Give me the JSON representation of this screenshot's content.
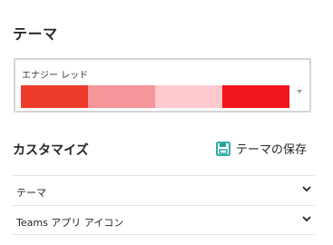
{
  "theme_section": {
    "title": "テーマ",
    "selected_theme": {
      "name": "エナジー レッド",
      "swatches": [
        "#ef3b2c",
        "#f6969a",
        "#fdc9cf",
        "#f2141e"
      ]
    }
  },
  "customize_section": {
    "title": "カスタマイズ",
    "save_label": "テーマの保存",
    "accent_color": "#1aa39b",
    "items": [
      {
        "label": "テーマ"
      },
      {
        "label": "Teams アプリ アイコン"
      }
    ]
  }
}
